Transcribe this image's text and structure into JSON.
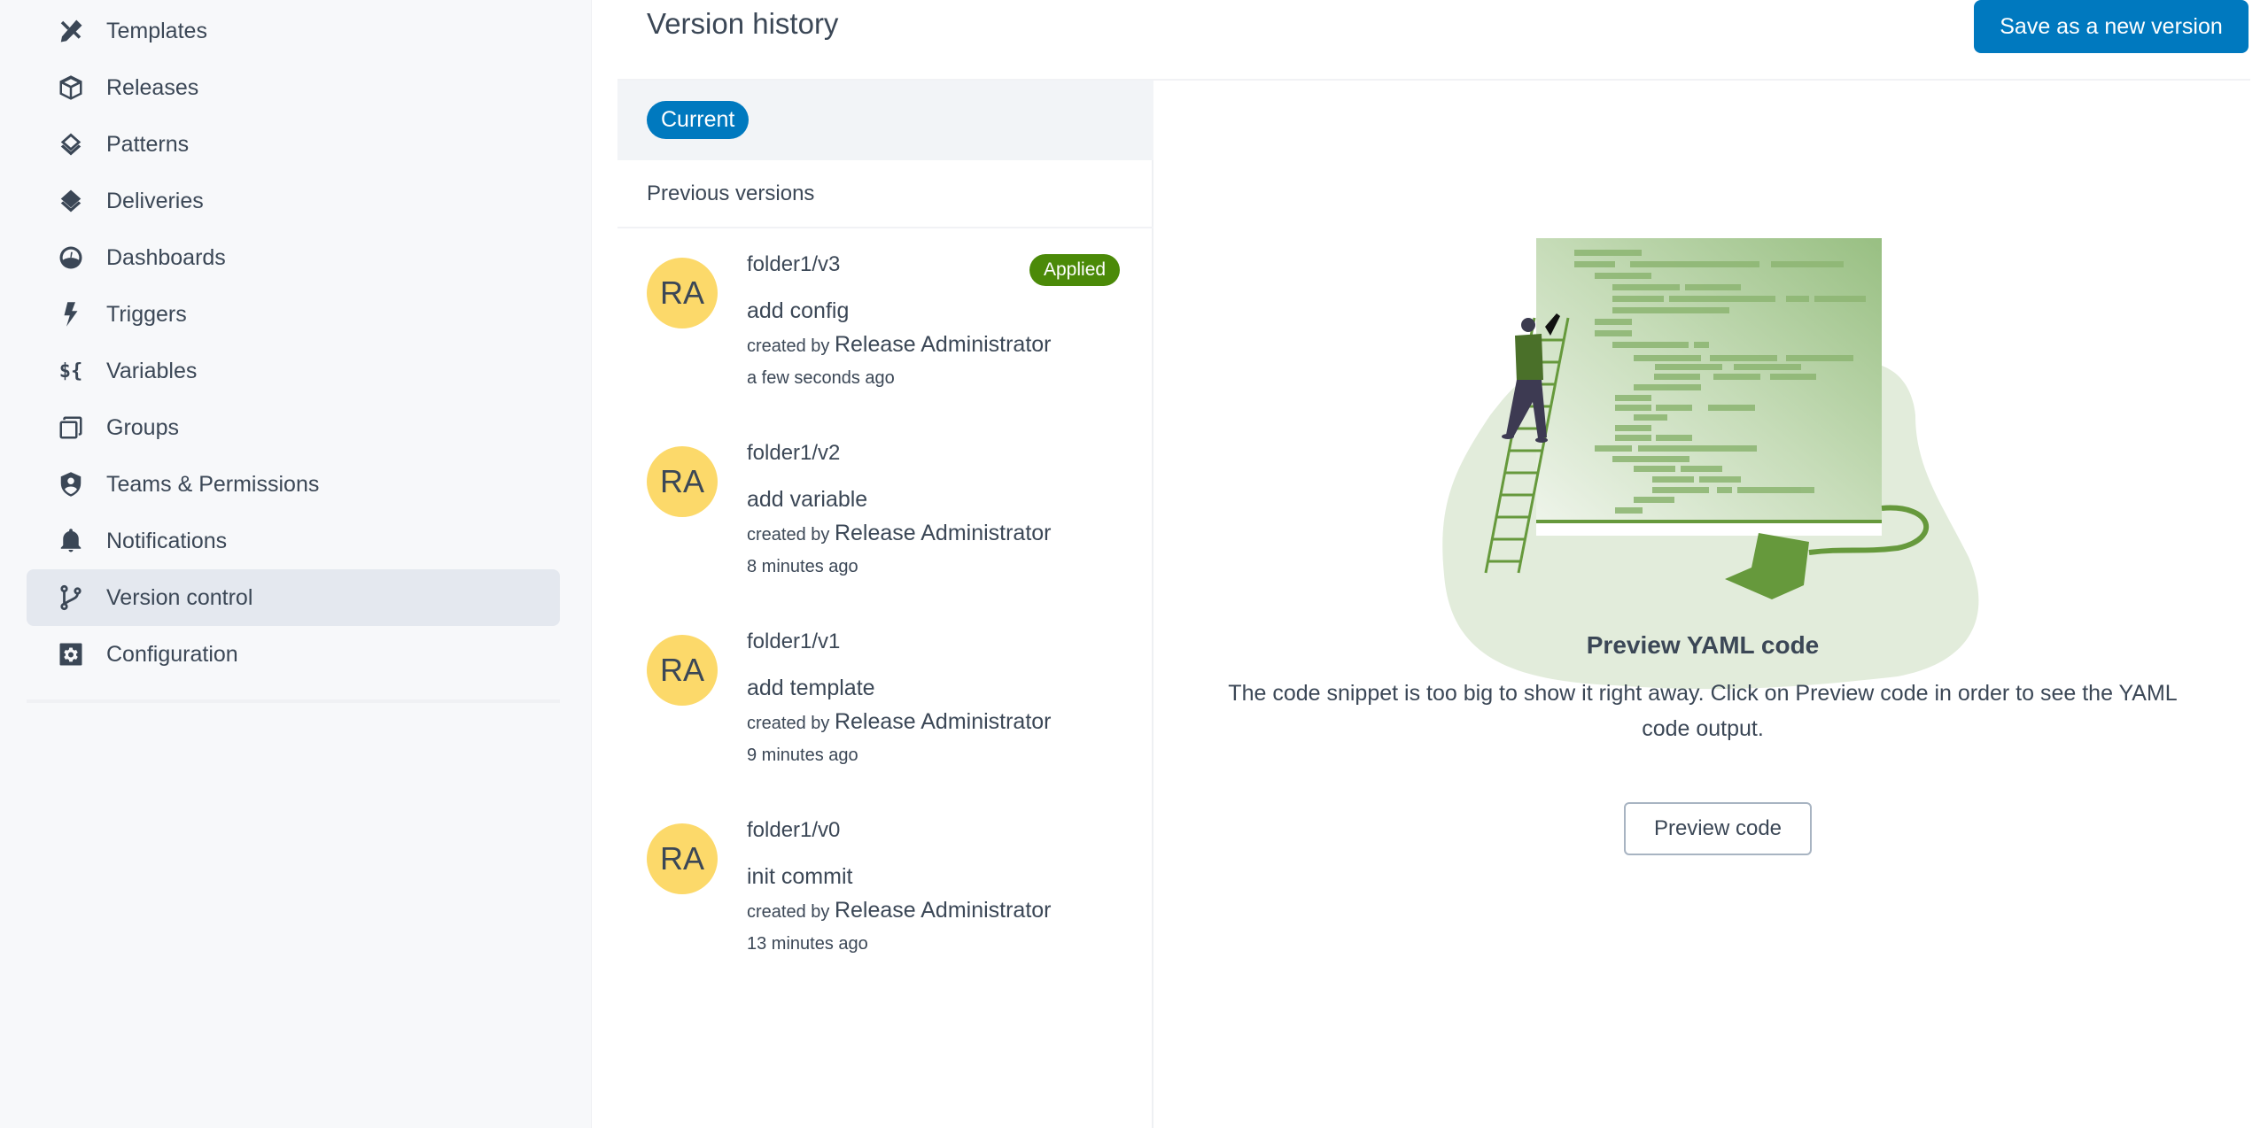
{
  "sidebar": {
    "items": [
      {
        "label": "Templates",
        "icon": "templates-icon"
      },
      {
        "label": "Releases",
        "icon": "releases-icon"
      },
      {
        "label": "Patterns",
        "icon": "patterns-icon"
      },
      {
        "label": "Deliveries",
        "icon": "deliveries-icon"
      },
      {
        "label": "Dashboards",
        "icon": "dashboards-icon"
      },
      {
        "label": "Triggers",
        "icon": "triggers-icon"
      },
      {
        "label": "Variables",
        "icon": "variables-icon"
      },
      {
        "label": "Groups",
        "icon": "groups-icon"
      },
      {
        "label": "Teams & Permissions",
        "icon": "teams-permissions-icon"
      },
      {
        "label": "Notifications",
        "icon": "notifications-icon"
      },
      {
        "label": "Version control",
        "icon": "version-control-icon",
        "active": true
      },
      {
        "label": "Configuration",
        "icon": "configuration-icon"
      }
    ],
    "variables_glyph": "${"
  },
  "header": {
    "title": "Version history",
    "save_label": "Save as a new version"
  },
  "versions": {
    "current_label": "Current",
    "previous_heading": "Previous versions",
    "created_by_label": "created by",
    "items": [
      {
        "initials": "RA",
        "name": "folder1/v3",
        "message": "add config",
        "author": "Release Administrator",
        "time": "a few seconds ago",
        "badge": "Applied"
      },
      {
        "initials": "RA",
        "name": "folder1/v2",
        "message": "add variable",
        "author": "Release Administrator",
        "time": "8 minutes ago"
      },
      {
        "initials": "RA",
        "name": "folder1/v1",
        "message": "add template",
        "author": "Release Administrator",
        "time": "9 minutes ago"
      },
      {
        "initials": "RA",
        "name": "folder1/v0",
        "message": "init commit",
        "author": "Release Administrator",
        "time": "13 minutes ago"
      }
    ]
  },
  "preview": {
    "title": "Preview YAML code",
    "description": "The code snippet is too big to show it right away. Click on Preview code in order to see the YAML code output.",
    "button_label": "Preview code"
  },
  "colors": {
    "primary": "#0079bf",
    "applied": "#4b8a08",
    "avatar": "#fcd96a",
    "text": "#3b4756",
    "active_nav": "#e4e8ef"
  }
}
